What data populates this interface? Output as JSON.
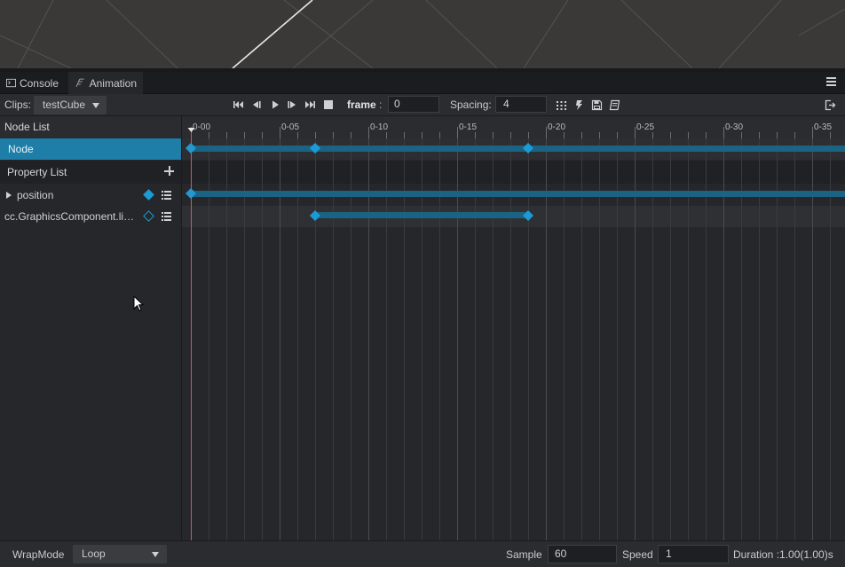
{
  "tabs": {
    "console": "Console",
    "animation": "Animation"
  },
  "toolbar": {
    "clips_label": "Clips:",
    "clip_selected": "testCube",
    "frame_label": "frame",
    "frame_colon": ":",
    "frame_value": "0",
    "spacing_label": "Spacing:",
    "spacing_value": "4"
  },
  "left_panel": {
    "node_list_label": "Node List",
    "node_name": "Node",
    "property_list_label": "Property List",
    "properties": [
      {
        "name": "position",
        "keyframe": "filled"
      },
      {
        "name": "cc.GraphicsComponent.lineWidth",
        "keyframe": "hollow"
      }
    ]
  },
  "timeline": {
    "tick_labels": [
      "0-00",
      "0-05",
      "0-10",
      "0-15",
      "0-20",
      "0-25",
      "0-30",
      "0-35"
    ],
    "current_frame": 0,
    "node_keyframes": [
      0,
      7,
      19
    ],
    "position_keyframes": [
      0
    ],
    "graphics_keyframes": [
      7,
      19
    ],
    "accent_color": "#1b9bd6",
    "playhead_color": "#e0505a"
  },
  "bottom": {
    "wrapmode_label": "WrapMode",
    "wrapmode_value": "Loop",
    "sample_label": "Sample",
    "sample_value": "60",
    "speed_label": "Speed",
    "speed_value": "1",
    "duration_text": "Duration :1.00(1.00)s"
  }
}
